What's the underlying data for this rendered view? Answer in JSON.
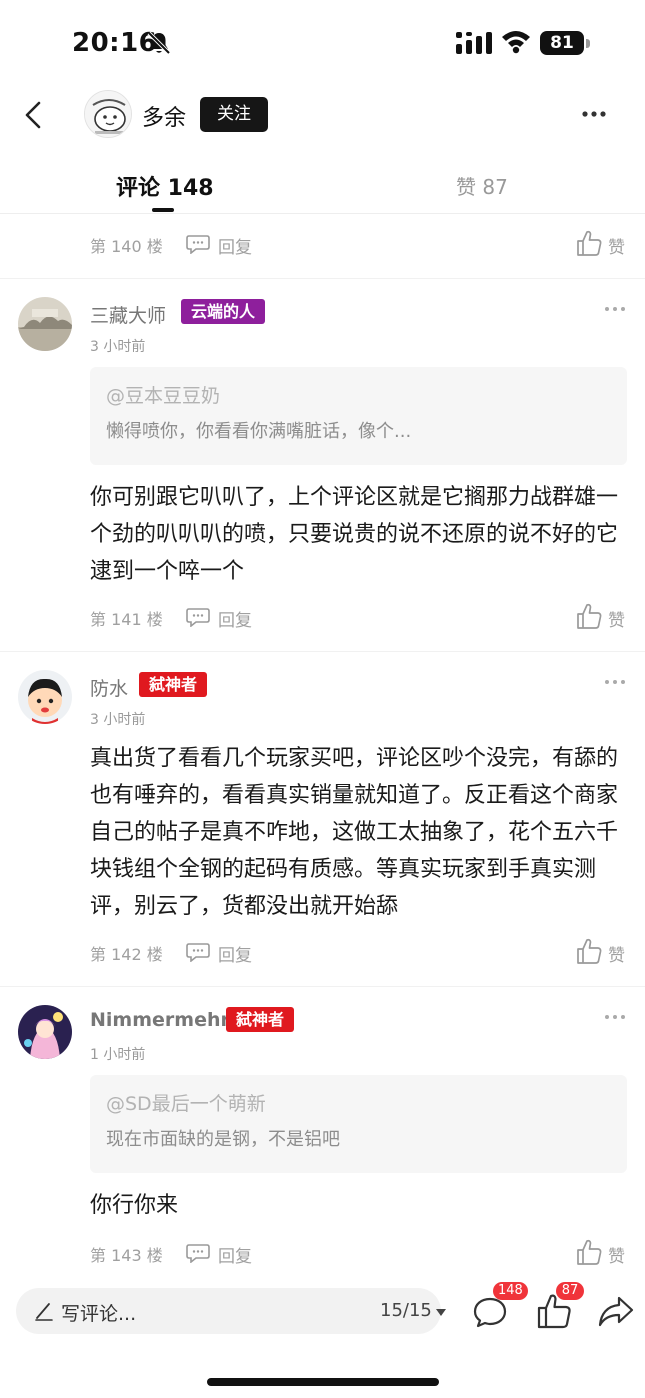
{
  "status_bar": {
    "time": "20:16",
    "battery": "81"
  },
  "header": {
    "author_name": "多余",
    "follow_label": "关注"
  },
  "tabs": {
    "comments_label": "评论 148",
    "likes_label": "赞 87"
  },
  "first_meta": {
    "floor": "第 140 楼",
    "reply_label": "回复",
    "like_label": "赞"
  },
  "comments": [
    {
      "user": "三藏大师",
      "badge": "云端的人",
      "time": "3 小时前",
      "quote_user": "@豆本豆豆奶",
      "quote_text": "懒得喷你，你看看你满嘴脏话，像个...",
      "text": "你可别跟它叭叭了，上个评论区就是它搁那力战群雄一个劲的叭叭叭的喷，只要说贵的说不还原的说不好的它逮到一个啐一个",
      "floor": "第 141 楼",
      "reply_label": "回复",
      "like_label": "赞"
    },
    {
      "user": "防水",
      "badge": "弑神者",
      "time": "3 小时前",
      "text": "真出货了看看几个玩家买吧，评论区吵个没完，有舔的也有唾弃的，看看真实销量就知道了。反正看这个商家自己的帖子是真不咋地，这做工太抽象了，花个五六千块钱组个全钢的起码有质感。等真实玩家到手真实测评，别云了，货都没出就开始舔",
      "floor": "第 142 楼",
      "reply_label": "回复",
      "like_label": "赞"
    },
    {
      "user": "Nimmermehr",
      "badge": "弑神者",
      "time": "1 小时前",
      "quote_user": "@SD最后一个萌新",
      "quote_text": "现在市面缺的是钢，不是铝吧",
      "text": "你行你来",
      "floor": "第 143 楼",
      "reply_label": "回复",
      "like_label": "赞"
    }
  ],
  "bottom_bar": {
    "input_label": "写评论...",
    "page_indicator": "15/15",
    "comment_count": "148",
    "like_count": "87"
  },
  "colors": {
    "badge_purple": "#8e1f9c",
    "badge_red": "#e0191f",
    "count_badge": "#f0343a"
  },
  "icons": [
    "bell-off-icon",
    "signal-icon",
    "wifi-icon",
    "back-icon",
    "more-icon",
    "reply-icon",
    "thumbs-up-icon",
    "pencil-icon",
    "caret-down-icon",
    "comment-bubble-icon",
    "share-icon"
  ]
}
